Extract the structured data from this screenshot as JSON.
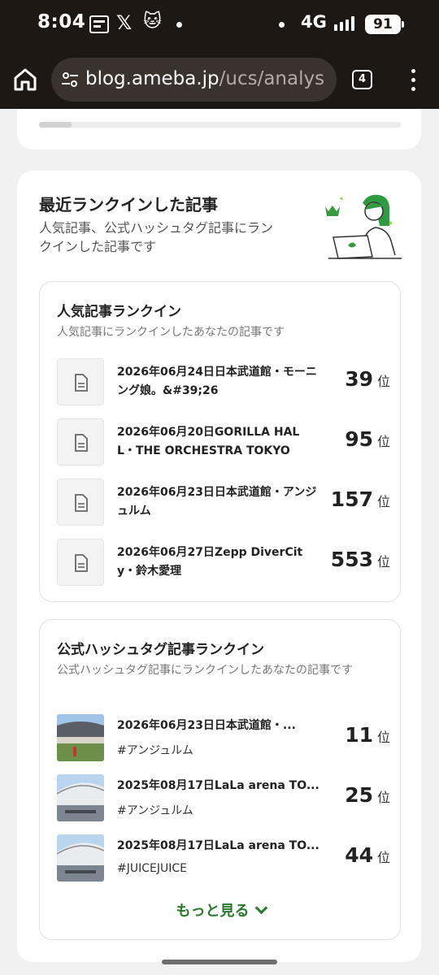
{
  "status_bar": {
    "time": "8:04",
    "network": "4G",
    "battery": "91"
  },
  "browser": {
    "url_host": "blog.ameba.jp",
    "url_path": "/ucs/analys",
    "tab_count": "4"
  },
  "previous_card": {
    "progress_fraction": 0.09
  },
  "card": {
    "title": "最近ランクインした記事",
    "description": "人気記事、公式ハッシュタグ記事にランクインした記事です"
  },
  "popular": {
    "title": "人気記事ランクイン",
    "description": "人気記事にランクインしたあなたの記事です",
    "rank_unit": "位",
    "items": [
      {
        "title": "2026年06月24日日本武道館・モーニング娘。&#39;26",
        "rank": "39"
      },
      {
        "title": "2026年06月20日GORILLA HALL・THE ORCHESTRA TOKYO",
        "rank": "95"
      },
      {
        "title": "2026年06月23日日本武道館・アンジュルム",
        "rank": "157"
      },
      {
        "title": "2026年06月27日Zepp DiverCity・鈴木愛理",
        "rank": "553"
      }
    ]
  },
  "hashtag": {
    "title": "公式ハッシュタグ記事ランクイン",
    "description": "公式ハッシュタグ記事にランクインしたあなたの記事です",
    "rank_unit": "位",
    "items": [
      {
        "title": "2026年06月23日日本武道館・...",
        "tag": "#アンジュルム",
        "rank": "11"
      },
      {
        "title": "2025年08月17日LaLa arena TO...",
        "tag": "#アンジュルム",
        "rank": "25"
      },
      {
        "title": "2025年08月17日LaLa arena TO...",
        "tag": "#JUICEJUICE",
        "rank": "44"
      }
    ],
    "more_label": "もっと見る"
  },
  "colors": {
    "accent_green": "#2a7a2e",
    "browser_chrome": "#1e1814"
  }
}
